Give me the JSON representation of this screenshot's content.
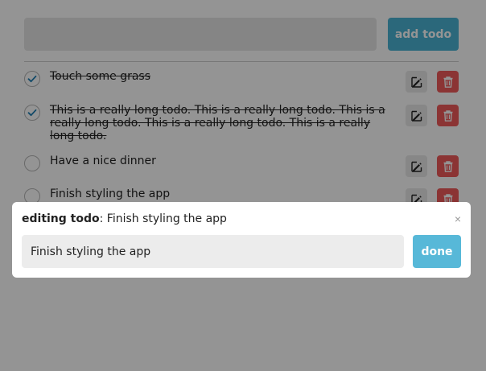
{
  "header": {
    "input_placeholder": "",
    "add_label": "add todo"
  },
  "todos": [
    {
      "text": "Touch some grass",
      "done": true
    },
    {
      "text": "This is a really long todo. This is a really long todo. This is a really long todo. This is a really long todo. This is a really long todo.",
      "done": true
    },
    {
      "text": "Have a nice dinner",
      "done": false
    },
    {
      "text": "Finish styling the app",
      "done": false
    }
  ],
  "icons": {
    "check": "check-icon",
    "edit": "edit-icon",
    "delete": "trash-icon",
    "close": "close-icon"
  },
  "modal": {
    "title_bold": "editing todo",
    "title_rest": ": Finish styling the app",
    "close_label": "×",
    "input_value": "Finish styling the app",
    "done_label": "done"
  },
  "colors": {
    "accent": "#4bb3d4",
    "danger": "#ef5b5b",
    "check": "#1e7fb4"
  }
}
